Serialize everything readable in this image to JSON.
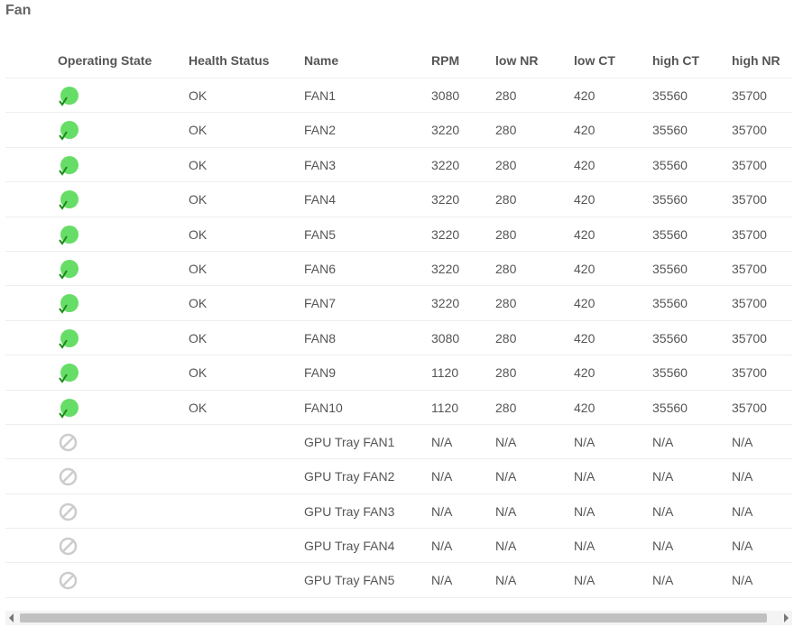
{
  "page": {
    "title": "Fan"
  },
  "table": {
    "headers": {
      "state": "Operating State",
      "health": "Health Status",
      "name": "Name",
      "rpm": "RPM",
      "low_nr": "low NR",
      "low_ct": "low CT",
      "high_ct": "high CT",
      "high_nr": "high NR"
    },
    "rows": [
      {
        "state": "ok",
        "health": "OK",
        "name": "FAN1",
        "rpm": "3080",
        "low_nr": "280",
        "low_ct": "420",
        "high_ct": "35560",
        "high_nr": "35700"
      },
      {
        "state": "ok",
        "health": "OK",
        "name": "FAN2",
        "rpm": "3220",
        "low_nr": "280",
        "low_ct": "420",
        "high_ct": "35560",
        "high_nr": "35700"
      },
      {
        "state": "ok",
        "health": "OK",
        "name": "FAN3",
        "rpm": "3220",
        "low_nr": "280",
        "low_ct": "420",
        "high_ct": "35560",
        "high_nr": "35700"
      },
      {
        "state": "ok",
        "health": "OK",
        "name": "FAN4",
        "rpm": "3220",
        "low_nr": "280",
        "low_ct": "420",
        "high_ct": "35560",
        "high_nr": "35700"
      },
      {
        "state": "ok",
        "health": "OK",
        "name": "FAN5",
        "rpm": "3220",
        "low_nr": "280",
        "low_ct": "420",
        "high_ct": "35560",
        "high_nr": "35700"
      },
      {
        "state": "ok",
        "health": "OK",
        "name": "FAN6",
        "rpm": "3220",
        "low_nr": "280",
        "low_ct": "420",
        "high_ct": "35560",
        "high_nr": "35700"
      },
      {
        "state": "ok",
        "health": "OK",
        "name": "FAN7",
        "rpm": "3220",
        "low_nr": "280",
        "low_ct": "420",
        "high_ct": "35560",
        "high_nr": "35700"
      },
      {
        "state": "ok",
        "health": "OK",
        "name": "FAN8",
        "rpm": "3080",
        "low_nr": "280",
        "low_ct": "420",
        "high_ct": "35560",
        "high_nr": "35700"
      },
      {
        "state": "ok",
        "health": "OK",
        "name": "FAN9",
        "rpm": "1120",
        "low_nr": "280",
        "low_ct": "420",
        "high_ct": "35560",
        "high_nr": "35700"
      },
      {
        "state": "ok",
        "health": "OK",
        "name": "FAN10",
        "rpm": "1120",
        "low_nr": "280",
        "low_ct": "420",
        "high_ct": "35560",
        "high_nr": "35700"
      },
      {
        "state": "na",
        "health": "",
        "name": "GPU Tray FAN1",
        "rpm": "N/A",
        "low_nr": "N/A",
        "low_ct": "N/A",
        "high_ct": "N/A",
        "high_nr": "N/A"
      },
      {
        "state": "na",
        "health": "",
        "name": "GPU Tray FAN2",
        "rpm": "N/A",
        "low_nr": "N/A",
        "low_ct": "N/A",
        "high_ct": "N/A",
        "high_nr": "N/A"
      },
      {
        "state": "na",
        "health": "",
        "name": "GPU Tray FAN3",
        "rpm": "N/A",
        "low_nr": "N/A",
        "low_ct": "N/A",
        "high_ct": "N/A",
        "high_nr": "N/A"
      },
      {
        "state": "na",
        "health": "",
        "name": "GPU Tray FAN4",
        "rpm": "N/A",
        "low_nr": "N/A",
        "low_ct": "N/A",
        "high_ct": "N/A",
        "high_nr": "N/A"
      },
      {
        "state": "na",
        "health": "",
        "name": "GPU Tray FAN5",
        "rpm": "N/A",
        "low_nr": "N/A",
        "low_ct": "N/A",
        "high_ct": "N/A",
        "high_nr": "N/A"
      }
    ]
  },
  "icons": {
    "ok": "status-ok-icon",
    "na": "not-available-icon"
  },
  "colors": {
    "ok_fill": "#66dd66",
    "ok_check": "#1a8a1a",
    "na_stroke": "#cccccc"
  }
}
